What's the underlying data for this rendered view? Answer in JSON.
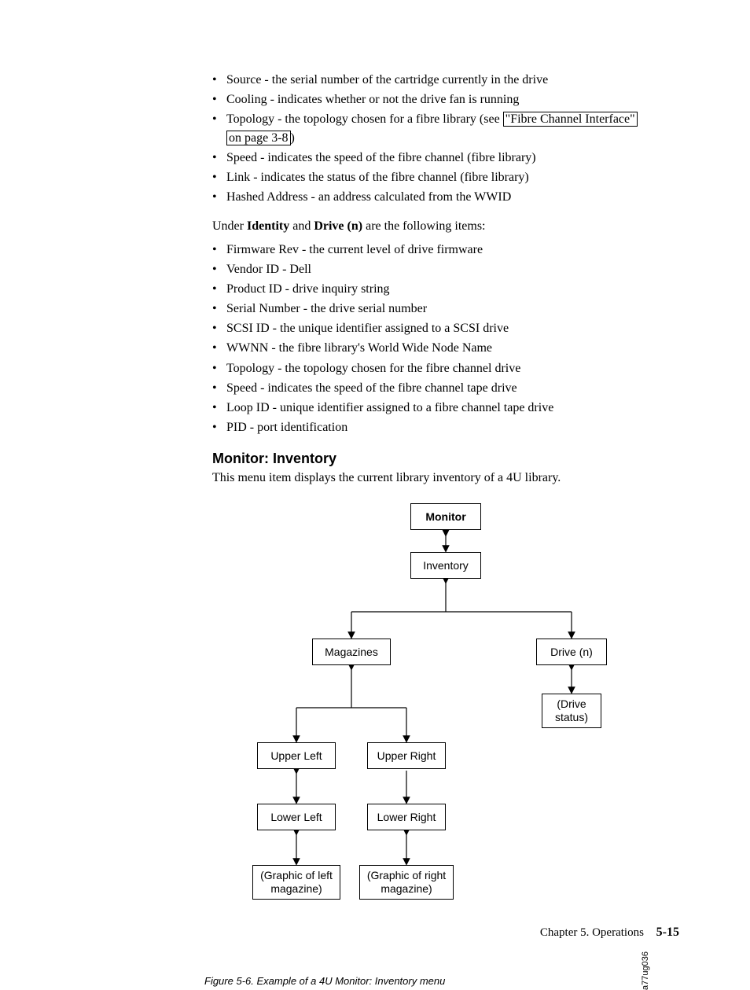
{
  "list1": [
    "Source - the serial number of the cartridge currently in the drive",
    "Cooling - indicates whether or not the drive fan is running"
  ],
  "list1_topology": {
    "prefix": "Topology - the topology chosen for a fibre library (see ",
    "link1": "\"Fibre Channel Interface\"",
    "link2": "on page 3-8",
    "suffix": ")"
  },
  "list1b": [
    "Speed - indicates the speed of the fibre channel (fibre library)",
    "Link - indicates the status of the fibre channel (fibre library)",
    "Hashed Address - an address calculated from the WWID"
  ],
  "para_identity": {
    "pre": "Under ",
    "b1": "Identity",
    "mid": " and ",
    "b2": "Drive (n)",
    "post": " are the following items:"
  },
  "list2": [
    "Firmware Rev - the current level of drive firmware",
    "Vendor ID - Dell",
    "Product ID - drive inquiry string",
    "Serial Number - the drive serial number",
    "SCSI ID - the unique identifier assigned to a SCSI drive",
    "WWNN - the fibre library's World Wide Node Name",
    "Topology - the topology chosen for the fibre channel drive",
    "Speed - indicates the speed of the fibre channel tape drive",
    "Loop ID - unique identifier assigned to a fibre channel tape drive",
    "PID - port identification"
  ],
  "section_heading": "Monitor: Inventory",
  "section_para": "This menu item displays the current library inventory of a 4U library.",
  "diagram": {
    "monitor": "Monitor",
    "inventory": "Inventory",
    "magazines": "Magazines",
    "drive_n": "Drive (n)",
    "drive_status": "(Drive status)",
    "upper_left": "Upper Left",
    "upper_right": "Upper Right",
    "lower_left": "Lower Left",
    "lower_right": "Lower Right",
    "graphic_left": "(Graphic of left magazine)",
    "graphic_right": "(Graphic of right magazine)",
    "code": "a77ug036"
  },
  "caption": "Figure 5-6. Example of a 4U Monitor: Inventory menu",
  "footer_chapter": "Chapter 5. Operations",
  "footer_page": "5-15"
}
